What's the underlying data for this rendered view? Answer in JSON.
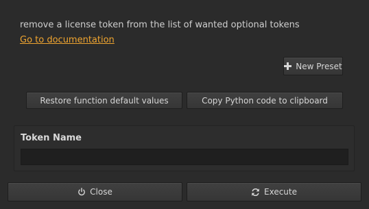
{
  "description": "remove a license token from the list of wanted optional tokens",
  "doc_link": "Go to documentation",
  "buttons": {
    "new_preset": "New Preset",
    "restore_defaults": "Restore function default values",
    "copy_python": "Copy Python code to clipboard",
    "close": "Close",
    "execute": "Execute"
  },
  "token_panel": {
    "label": "Token Name",
    "value": ""
  },
  "icons": {
    "new_preset": "plus-icon",
    "close": "power-icon",
    "execute": "refresh-icon"
  },
  "colors": {
    "background": "#2b2b2b",
    "link": "#f0a530",
    "button": "#3c3c3c",
    "input": "#1f1f1f"
  }
}
